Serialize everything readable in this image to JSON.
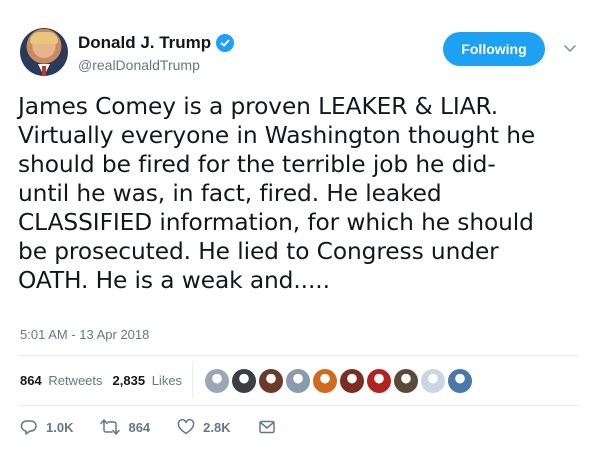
{
  "user": {
    "display_name": "Donald J. Trump",
    "handle": "@realDonaldTrump",
    "verified_icon": "verified-badge-icon",
    "follow_label": "Following"
  },
  "tweet": {
    "lines": [
      "James Comey is a proven LEAKER & LIAR.",
      "Virtually everyone in Washington thought he",
      "should be fired for the terrible job he did-",
      "until he was, in fact, fired. He leaked",
      "CLASSIFIED information, for which he should",
      "be prosecuted. He lied to Congress under",
      "OATH. He is a weak and....."
    ],
    "timestamp": "5:01 AM - 13 Apr 2018"
  },
  "stats": {
    "retweets_count": "864",
    "retweets_label": "Retweets",
    "likes_count": "2,835",
    "likes_label": "Likes"
  },
  "likers": [
    {
      "color": "#9aa8b5"
    },
    {
      "color": "#3b3f44"
    },
    {
      "color": "#6b3b2a"
    },
    {
      "color": "#8a9bb0"
    },
    {
      "color": "#d2691e"
    },
    {
      "color": "#7a2e22"
    },
    {
      "color": "#b22222"
    },
    {
      "color": "#5a4a3a"
    },
    {
      "color": "#c9d6e3"
    },
    {
      "color": "#4a78a8"
    }
  ],
  "actions": {
    "reply_count": "1.0K",
    "retweet_count": "864",
    "like_count": "2.8K"
  },
  "colors": {
    "accent": "#1da1f2",
    "secondary_text": "#657786",
    "divider": "#e6ecf0"
  }
}
